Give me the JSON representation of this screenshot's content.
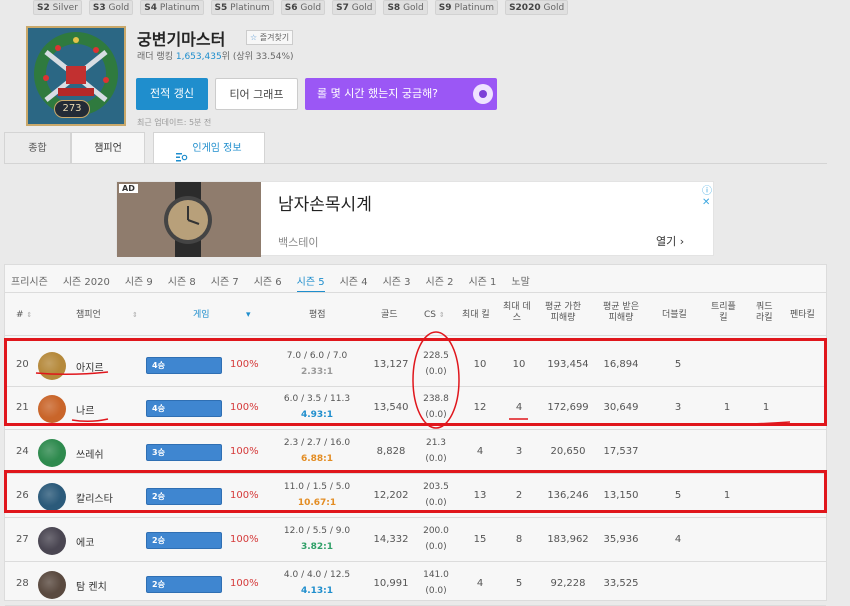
{
  "badges": [
    {
      "season": "S2",
      "tier": "Silver"
    },
    {
      "season": "S3",
      "tier": "Gold"
    },
    {
      "season": "S4",
      "tier": "Platinum"
    },
    {
      "season": "S5",
      "tier": "Platinum"
    },
    {
      "season": "S6",
      "tier": "Gold"
    },
    {
      "season": "S7",
      "tier": "Gold"
    },
    {
      "season": "S8",
      "tier": "Gold"
    },
    {
      "season": "S9",
      "tier": "Platinum"
    },
    {
      "season": "S2020",
      "tier": "Gold"
    }
  ],
  "profile": {
    "name": "궁변기마스터",
    "level": "273",
    "favorite_label": "즐겨찾기",
    "rank_prefix": "래더 랭킹",
    "rank_number": "1,653,435",
    "rank_suffix": "위 (상위 33.54%)",
    "updated": "최근 업데이트: 5분 전"
  },
  "buttons": {
    "refresh": "전적 갱신",
    "tier_graph": "티어 그래프",
    "time_played": "롤 몇 시간 했는지 궁금해?"
  },
  "tabs": {
    "summary": "종합",
    "champions": "챔피언",
    "ingame": "인게임 정보"
  },
  "ad": {
    "tag": "AD",
    "title": "남자손목시계",
    "brand": "백스테이",
    "open": "열기 ›",
    "info": "ⓘ ✕"
  },
  "seasons": [
    "프리시즌",
    "시즌 2020",
    "시즌 9",
    "시즌 8",
    "시즌 7",
    "시즌 6",
    "시즌 5",
    "시즌 4",
    "시즌 3",
    "시즌 2",
    "시즌 1",
    "노말"
  ],
  "active_season_index": 6,
  "table": {
    "headers": {
      "num": "#",
      "champion": "챔피언",
      "games": "게임",
      "kda": "평점",
      "gold": "골드",
      "cs": "CS",
      "max_kills": "최대 킬",
      "max_deaths_1": "최대 데",
      "max_deaths_2": "스",
      "avg_dealt_1": "평균 가한",
      "avg_dealt_2": "피해량",
      "avg_taken_1": "평균 받은",
      "avg_taken_2": "피해량",
      "double": "더블킬",
      "triple_1": "트리플",
      "triple_2": "킬",
      "quadra_1": "쿼드",
      "quadra_2": "라킬",
      "penta": "펜타킬"
    },
    "rows": [
      {
        "rank": "20",
        "name": "아지르",
        "wins": "4승",
        "winrate": "100%",
        "kda": "7.0 / 6.0 / 7.0",
        "ratio": "2.33:1",
        "ratio_color": "#999999",
        "gold": "13,127",
        "cs": "228.5",
        "cs_sub": "(0.0)",
        "max_kills": "10",
        "max_deaths": "10",
        "dealt": "193,454",
        "taken": "16,894",
        "double": "5",
        "triple": "",
        "quadra": "",
        "icon_color": "#b5893b"
      },
      {
        "rank": "21",
        "name": "나르",
        "wins": "4승",
        "winrate": "100%",
        "kda": "6.0 / 3.5 / 11.3",
        "ratio": "4.93:1",
        "ratio_color": "#1f8ecd",
        "gold": "13,540",
        "cs": "238.8",
        "cs_sub": "(0.0)",
        "max_kills": "12",
        "max_deaths": "4",
        "dealt": "172,699",
        "taken": "30,649",
        "double": "3",
        "triple": "1",
        "quadra": "1",
        "icon_color": "#c9652a"
      },
      {
        "rank": "24",
        "name": "쓰레쉬",
        "wins": "3승",
        "winrate": "100%",
        "kda": "2.3 / 2.7 / 16.0",
        "ratio": "6.88:1",
        "ratio_color": "#e38d24",
        "gold": "8,828",
        "cs": "21.3",
        "cs_sub": "(0.0)",
        "max_kills": "4",
        "max_deaths": "3",
        "dealt": "20,650",
        "taken": "17,537",
        "double": "",
        "triple": "",
        "quadra": "",
        "icon_color": "#2e8a4e"
      },
      {
        "rank": "26",
        "name": "칼리스타",
        "wins": "2승",
        "winrate": "100%",
        "kda": "11.0 / 1.5 / 5.0",
        "ratio": "10.67:1",
        "ratio_color": "#e38d24",
        "gold": "12,202",
        "cs": "203.5",
        "cs_sub": "(0.0)",
        "max_kills": "13",
        "max_deaths": "2",
        "dealt": "136,246",
        "taken": "13,150",
        "double": "5",
        "triple": "1",
        "quadra": "",
        "icon_color": "#2b5a7a"
      },
      {
        "rank": "27",
        "name": "에코",
        "wins": "2승",
        "winrate": "100%",
        "kda": "12.0 / 5.5 / 9.0",
        "ratio": "3.82:1",
        "ratio_color": "#2fa068",
        "gold": "14,332",
        "cs": "200.0",
        "cs_sub": "(0.0)",
        "max_kills": "15",
        "max_deaths": "8",
        "dealt": "183,962",
        "taken": "35,936",
        "double": "4",
        "triple": "",
        "quadra": "",
        "icon_color": "#4a4652"
      },
      {
        "rank": "28",
        "name": "탐 켄치",
        "wins": "2승",
        "winrate": "100%",
        "kda": "4.0 / 4.0 / 12.5",
        "ratio": "4.13:1",
        "ratio_color": "#1f8ecd",
        "gold": "10,991",
        "cs": "141.0",
        "cs_sub": "(0.0)",
        "max_kills": "4",
        "max_deaths": "5",
        "dealt": "92,228",
        "taken": "33,525",
        "double": "",
        "triple": "",
        "quadra": "",
        "icon_color": "#5a4a40"
      }
    ]
  },
  "colors": {
    "accent": "#1f8ecd",
    "annotation": "#e0161c",
    "purple": "#9b57f5",
    "bar": "#3f86d0"
  }
}
